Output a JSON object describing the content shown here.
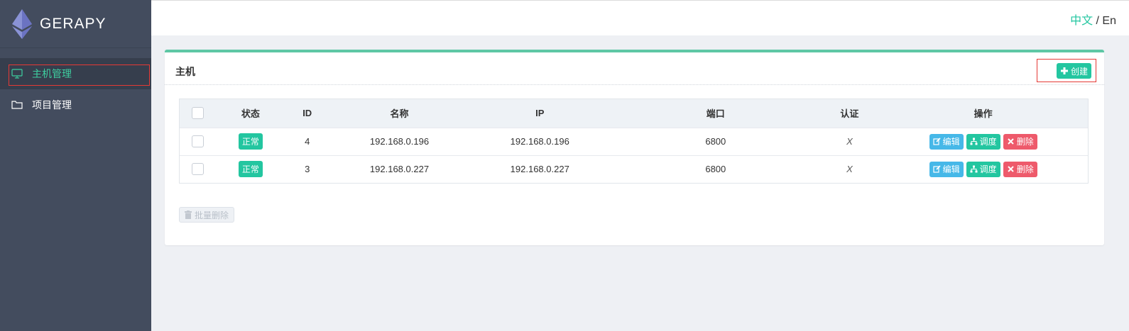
{
  "app": {
    "logo_text": "GERAPY"
  },
  "sidebar": {
    "items": [
      {
        "label": "主机管理",
        "icon": "monitor-icon",
        "active": true
      },
      {
        "label": "项目管理",
        "icon": "folder-icon",
        "active": false
      }
    ]
  },
  "topbar": {
    "lang_zh": "中文",
    "lang_sep": " / ",
    "lang_en": "En"
  },
  "card": {
    "title": "主机",
    "create_label": "创建",
    "batch_delete_label": "批量删除"
  },
  "table": {
    "headers": {
      "status": "状态",
      "id": "ID",
      "name": "名称",
      "ip": "IP",
      "port": "端口",
      "auth": "认证",
      "ops": "操作"
    },
    "rows": [
      {
        "status": "正常",
        "id": "4",
        "name": "192.168.0.196",
        "ip": "192.168.0.196",
        "port": "6800",
        "auth": "X"
      },
      {
        "status": "正常",
        "id": "3",
        "name": "192.168.0.227",
        "ip": "192.168.0.227",
        "port": "6800",
        "auth": "X"
      }
    ],
    "ops": {
      "edit": "编辑",
      "schedule": "调度",
      "delete": "删除"
    }
  },
  "colors": {
    "accent": "#23c6a0",
    "sidebar_bg": "#434c5e",
    "edit": "#46b8e8",
    "delete": "#ee5a6b"
  }
}
